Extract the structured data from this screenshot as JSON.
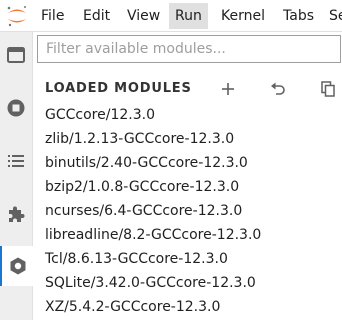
{
  "menubar": {
    "items": [
      {
        "label": "File"
      },
      {
        "label": "Edit"
      },
      {
        "label": "View"
      },
      {
        "label": "Run"
      },
      {
        "label": "Kernel"
      },
      {
        "label": "Tabs"
      },
      {
        "label": "Se"
      }
    ],
    "active": "Run"
  },
  "rail": {
    "icons": [
      "folder-icon",
      "stop-circle-icon",
      "list-icon",
      "extension-puzzle-icon",
      "hexagon-module-icon"
    ],
    "accent_color": "#1976d2"
  },
  "panel": {
    "search": {
      "placeholder": "Filter available modules...",
      "value": ""
    },
    "section_title": "LOADED MODULES",
    "header_actions": [
      "add-icon",
      "undo-icon",
      "copy-icon"
    ],
    "modules": [
      "GCCcore/12.3.0",
      "zlib/1.2.13-GCCcore-12.3.0",
      "binutils/2.40-GCCcore-12.3.0",
      "bzip2/1.0.8-GCCcore-12.3.0",
      "ncurses/6.4-GCCcore-12.3.0",
      "libreadline/8.2-GCCcore-12.3.0",
      "Tcl/8.6.13-GCCcore-12.3.0",
      "SQLite/3.42.0-GCCcore-12.3.0",
      "XZ/5.4.2-GCCcore-12.3.0"
    ]
  },
  "colors": {
    "logo_orange": "#f37726",
    "icon_gray": "#616161"
  }
}
